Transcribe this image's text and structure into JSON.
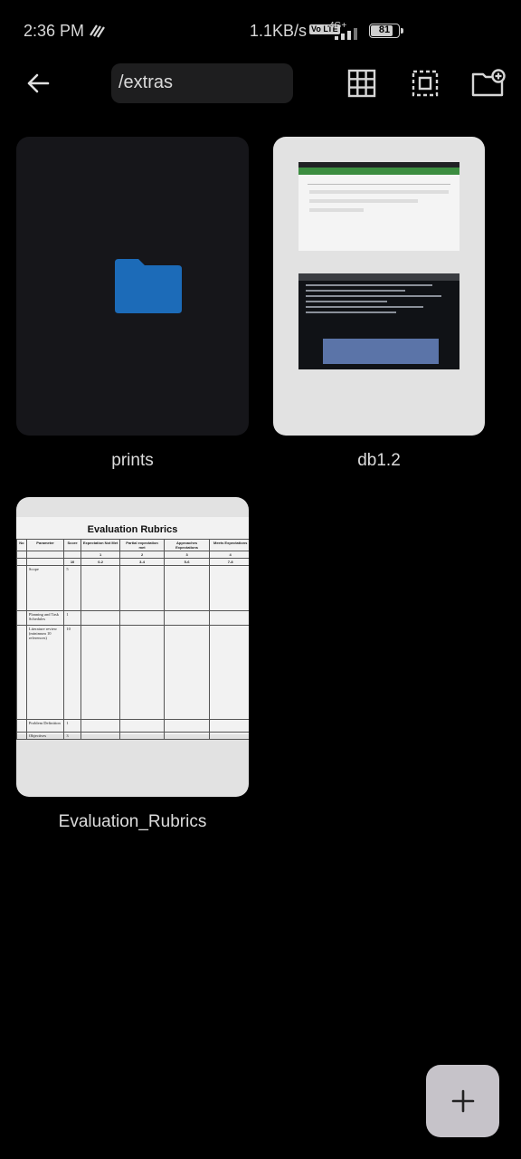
{
  "status_bar": {
    "time": "2:36 PM",
    "net_speed": "1.1KB/s",
    "volte": "Vo LTE",
    "network_type": "4G+",
    "battery": "81",
    "battery_level": 0.81
  },
  "toolbar": {
    "path": "/extras",
    "icons": [
      "back-arrow-icon",
      "grid-view-icon",
      "select-all-icon",
      "new-folder-icon"
    ]
  },
  "items": [
    {
      "name": "prints",
      "type": "folder",
      "icon": "folder-icon",
      "icon_color": "#1c6bb8"
    },
    {
      "name": "db1.2",
      "type": "image"
    },
    {
      "name": "Evaluation_Rubrics",
      "type": "image"
    }
  ],
  "eval_preview": {
    "title": "Evaluation Rubrics",
    "headers": [
      "No",
      "Parameter",
      "Score",
      "Expectation Not Met",
      "Partial expectation met",
      "Approaches Expectations",
      "Meets Expectations"
    ],
    "score_row": [
      "",
      "",
      "",
      "1",
      "2",
      "3",
      "4"
    ],
    "range_row": [
      "",
      "",
      "10",
      "0-2",
      "3-4",
      "5-6",
      "7-8"
    ],
    "rows": [
      {
        "param": "Scope",
        "score": "5"
      },
      {
        "param": "Planning and Task Schedules",
        "score": "1"
      },
      {
        "param": "Literature review (minimum 10 references)",
        "score": "10"
      },
      {
        "param": "Problem Definition",
        "score": "1"
      },
      {
        "param": "Objectives",
        "score": "3"
      }
    ]
  },
  "fab": {
    "icon": "plus-icon"
  },
  "colors": {
    "background": "#000000",
    "accent_folder": "#1c6bb8",
    "fab": "#c6c3c9"
  }
}
